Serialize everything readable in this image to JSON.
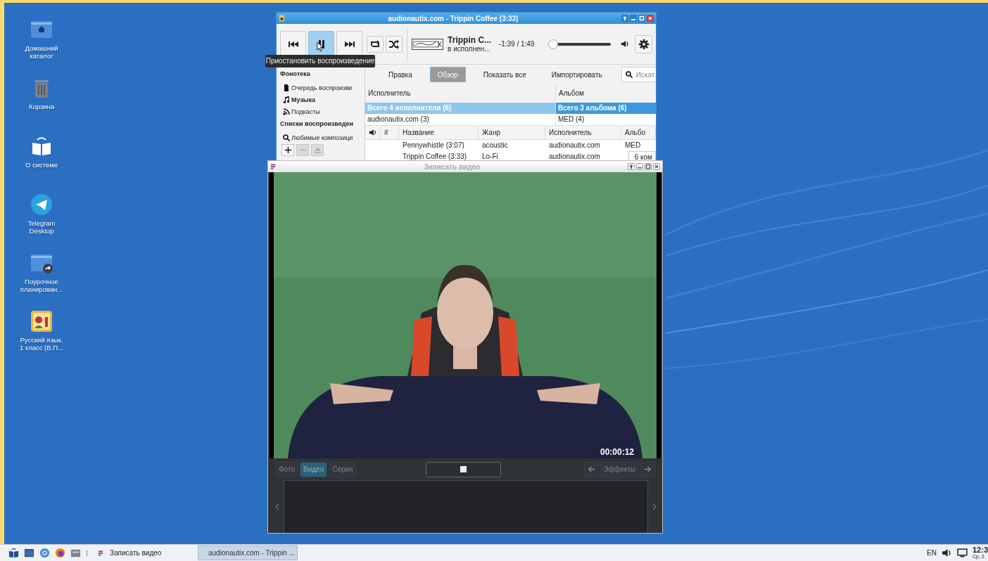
{
  "desktop": {
    "icons": [
      {
        "kind": "home",
        "label": "Домашний каталог"
      },
      {
        "kind": "trash",
        "label": "Корзина"
      },
      {
        "kind": "about",
        "label": "О системе"
      },
      {
        "kind": "telegram",
        "label": "Telegram Desktop"
      },
      {
        "kind": "link-folder",
        "label": "Поурочное планирован..."
      },
      {
        "kind": "app",
        "label": "Русский язык. 1 класс (В.П..."
      }
    ]
  },
  "player": {
    "title": "audionautix.com - Trippin Coffee (3:33)",
    "transport": [
      {
        "kind": "prev",
        "hover": false
      },
      {
        "kind": "pause",
        "hover": true
      },
      {
        "kind": "next",
        "hover": false
      }
    ],
    "modes": [
      {
        "kind": "repeat"
      },
      {
        "kind": "shuffle"
      }
    ],
    "track_title": "Trippin C...",
    "track_artist": "в исполнен...",
    "time": "-1:39 / 1:49",
    "volume": {
      "level": 0.0
    },
    "tooltip": "Приостановить воспроизведение",
    "sidebar": [
      {
        "kind": "header",
        "label": "Фонотека"
      },
      {
        "kind": "queue",
        "label": "Очередь воспроизве",
        "selected": false
      },
      {
        "kind": "music",
        "label": "Музыка",
        "selected": true
      },
      {
        "kind": "podcasts",
        "label": "Подкасты",
        "selected": false
      },
      {
        "kind": "header",
        "label": "Списки воспроизведен"
      },
      {
        "kind": "playlist",
        "label": "Любимые композици",
        "selected": false
      }
    ],
    "sidebar_buttons": [
      {
        "kind": "add",
        "disabled": false
      },
      {
        "kind": "remove",
        "disabled": true
      },
      {
        "kind": "eject",
        "disabled": true
      }
    ],
    "tabs": [
      {
        "label": "Правка",
        "selected": false
      },
      {
        "label": "Обзор",
        "selected": true
      },
      {
        "label": "Показать все",
        "selected": false
      },
      {
        "label": "Импортировать",
        "selected": false
      }
    ],
    "search": {
      "placeholder": "Искат"
    },
    "browser": [
      {
        "heading": "Исполнитель",
        "rows": [
          {
            "label": "Всего 4 исполнителя (6)",
            "selected": true
          },
          {
            "label": "audionautix.com (3)",
            "selected": false
          }
        ]
      },
      {
        "heading": "Альбом",
        "rows": [
          {
            "label": "Всего 3 альбома (6)",
            "selected": true
          },
          {
            "label": "MED (4)",
            "selected": false
          }
        ]
      }
    ],
    "track_columns": [
      "#",
      "Название",
      "Жанр",
      "Исполнитель",
      "Альбо"
    ],
    "tracks": [
      {
        "cells": [
          "",
          "Pennywhistle (3:07)",
          "acoustic",
          "audionautix.com",
          "MED"
        ]
      },
      {
        "cells": [
          "",
          "Trippin Coffee (3:33)",
          "Lo-Fi",
          "audionautix.com",
          ""
        ]
      }
    ],
    "status_popup": "6 ком"
  },
  "camera": {
    "title": "Записать видео",
    "timer": "00:00:12",
    "modes": [
      {
        "label": "Фото",
        "selected": false
      },
      {
        "label": "Видео",
        "selected": true
      },
      {
        "label": "Серия",
        "selected": false
      }
    ],
    "effects": "Эффекты"
  },
  "taskbar": {
    "tasks": [
      {
        "kind": "camera",
        "label": "Записать видео",
        "selected": false
      },
      {
        "kind": "player",
        "label": "audionautix.com - Trippin ...",
        "selected": true
      }
    ],
    "language": "EN",
    "clock": "12:3",
    "date": "Ср, 2"
  }
}
